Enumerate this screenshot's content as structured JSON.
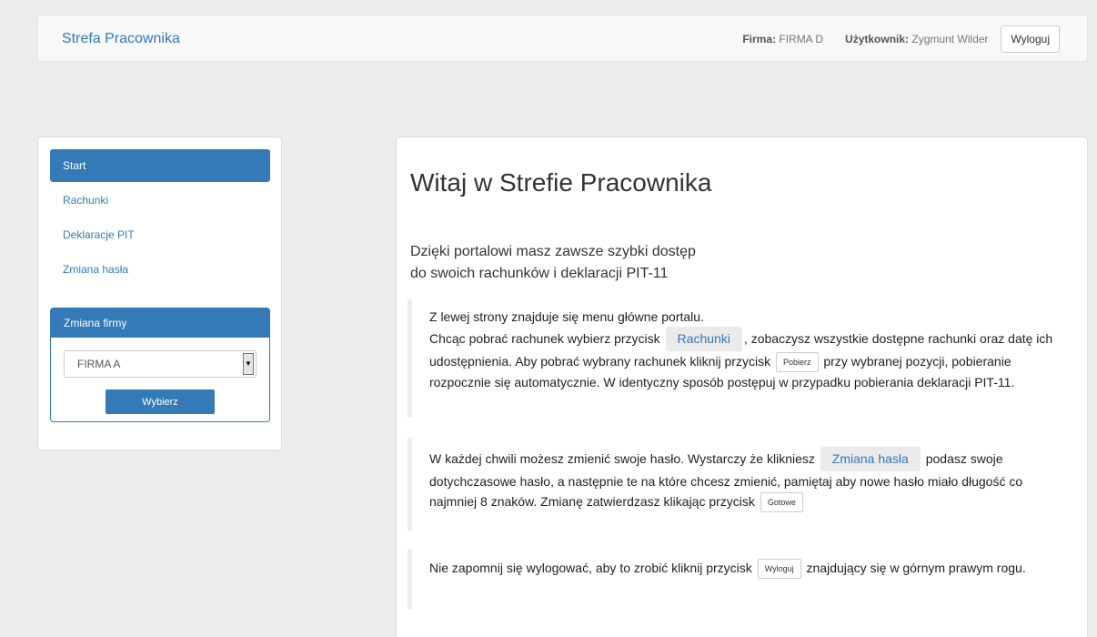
{
  "navbar": {
    "brand": "Strefa Pracownika",
    "firm_label": "Firma:",
    "firm_value": "FIRMA D",
    "user_label": "Użytkownik:",
    "user_value": "Zygmunt Wilder",
    "logout_label": "Wyloguj"
  },
  "sidebar": {
    "items": [
      {
        "label": "Start"
      },
      {
        "label": "Rachunki"
      },
      {
        "label": "Deklaracje PIT"
      },
      {
        "label": "Zmiana hasła"
      }
    ],
    "firm_panel": {
      "title": "Zmiana firmy",
      "selected": "FIRMA A",
      "button": "Wybierz"
    }
  },
  "main": {
    "title": "Witaj w Strefie Pracownika",
    "lead_line1": "Dzięki portalowi masz zawsze szybki dostęp",
    "lead_line2": "do swoich rachunków i deklaracji PIT-11",
    "p1": {
      "line1": "Z lewej strony znajduje się menu główne portalu.",
      "a": "Chcąc pobrać rachunek wybierz przycisk",
      "chip": "Rachunki",
      "b": ", zobaczysz wszystkie dostępne rachunki oraz datę ich udostępnienia. Aby pobrać wybrany rachunek kliknij przycisk",
      "btn": "Pobierz",
      "c": "przy wybranej pozycji, pobieranie rozpocznie się automatycznie. W identyczny sposób postępuj w przypadku pobierania deklaracji PIT-11."
    },
    "p2": {
      "a": "W każdej chwili możesz zmienić swoje hasło. Wystarczy że klikniesz",
      "chip": "Zmiana hasła",
      "b": "podasz swoje dotychczasowe hasło, a następnie te na które chcesz zmienić, pamiętaj aby nowe hasło miało długość co najmniej 8 znaków. Zmianę zatwierdzasz klikając przycisk",
      "btn": "Gotowe"
    },
    "p3": {
      "a": "Nie zapomnij się wylogować, aby to zrobić kliknij przycisk",
      "btn": "Wyloguj",
      "b": "znajdujący się w górnym prawym rogu."
    }
  }
}
